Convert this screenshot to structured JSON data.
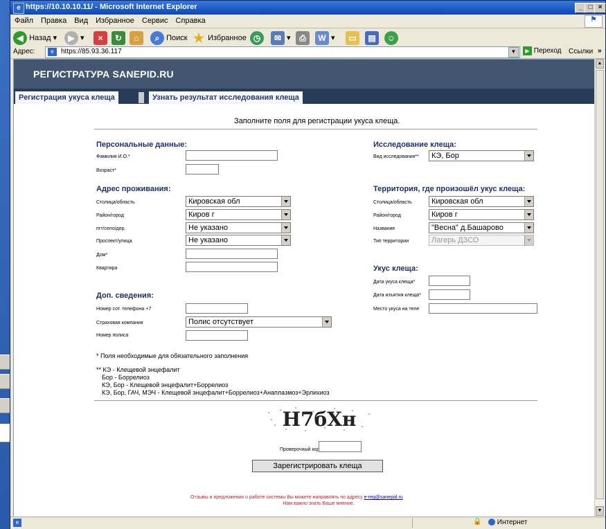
{
  "window": {
    "title": "https://10.10.10.11/ - Microsoft Internet Explorer",
    "menu": [
      "Файл",
      "Правка",
      "Вид",
      "Избранное",
      "Сервис",
      "Справка"
    ],
    "toolbar": {
      "back": "Назад",
      "search": "Поиск",
      "favorites": "Избранное"
    },
    "address_label": "Адрес:",
    "address_value": "https://85.93.36.117",
    "go_label": "Переход",
    "links_label": "Ссылки",
    "status_zone": "Интернет"
  },
  "page": {
    "header_title": "РЕГИСТРАТУРА SANEPID.RU",
    "tabs": [
      "Регистрация укуса клеща",
      "Узнать результат исследования клеща"
    ],
    "intro": "Заполните поля для регистрации укуса клеща.",
    "personal": {
      "title": "Персональные данные:",
      "fio_label": "Фамилия И.О.*",
      "age_label": "Возраст*"
    },
    "address": {
      "title": "Адрес проживания:",
      "region_label": "Столица/область",
      "region_value": "Кировская обл",
      "district_label": "Район/город",
      "district_value": "Киров г",
      "settlement_label": "пгт/село/дер.",
      "settlement_value": "Не указано",
      "street_label": "Проспект/улица",
      "street_value": "Не указано",
      "house_label": "Дом*",
      "flat_label": "Квартира"
    },
    "extra": {
      "title": "Доп. сведения:",
      "phone_label": "Номер сот. телефона +7",
      "insurance_label": "Страховая компания",
      "insurance_value": "Полис отсутствует",
      "policy_label": "Номер полиса"
    },
    "research": {
      "title": "Исследование клеща:",
      "type_label": "Вид исследования**",
      "type_value": "КЭ, Бор"
    },
    "territory": {
      "title": "Территория, где произошёл укус клеща:",
      "region_label": "Столица/область",
      "region_value": "Кировская обл",
      "district_label": "Район/город",
      "district_value": "Киров г",
      "name_label": "Название",
      "name_value": "\"Весна\" д.Башарово",
      "type_label": "Тип территории",
      "type_value": "Лагерь ДЗСО"
    },
    "bite": {
      "title": "Укус клеща:",
      "date_bite_label": "Дата укуса клеща*",
      "date_remove_label": "Дата изъятия клеща*",
      "place_label": "Место укуса на теле"
    },
    "notes": {
      "required": "* Поля необходимые для обязательного заполнения",
      "legend": [
        "** КЭ - Клещевой энцефалит",
        "Бор - Боррелиоз",
        "КЭ, Бор - Клещевой энцефалит+Боррелиоз",
        "КЭ, Бор, ГАЧ, МЭЧ - Клещевой энцефалит+Боррелиоз+Анаплазмоз+Эрлихиоз"
      ]
    },
    "captcha_text": "H7бXн",
    "check_code_label": "Проверочный код",
    "submit_label": "Зарегистрировать клеща",
    "footer_line1": "Отзывы и предложения о работе системы Вы можете направлять по адресу",
    "footer_email": "e-reg@sanepid.ru",
    "footer_line2": "Нам важно знать Ваше мнение."
  }
}
